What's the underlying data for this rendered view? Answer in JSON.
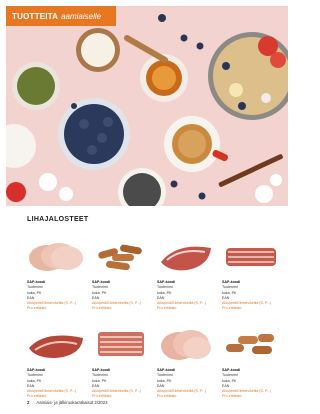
{
  "banner": {
    "part1": "TUOTTEITA",
    "part2": "aamiaiselle"
  },
  "section_title": "LIHAJALOSTEET",
  "products": [
    {
      "line1": "SAP-koodi",
      "line2": "Tuotenimi",
      "line3": "kuka, PK",
      "line4": "EAN",
      "price": "Alkuperä/Elintarviketila (S, P...)",
      "origin": "Pro-ertiiesto"
    },
    {
      "line1": "SAP-koodi",
      "line2": "Tuotenimi",
      "line3": "kuka, PK",
      "line4": "EAN",
      "price": "Alkuperä/Elintarviketila (S, P...)",
      "origin": "Pro-ertiiesto"
    },
    {
      "line1": "SAP-koodi",
      "line2": "Tuotenimi",
      "line3": "kuka, PK",
      "line4": "EAN",
      "price": "Alkuperä/Elintarviketila (S, P...)",
      "origin": "Pro-ertiiesto"
    },
    {
      "line1": "SAP-koodi",
      "line2": "Tuotenimi",
      "line3": "kuka, PK",
      "line4": "EAN",
      "price": "Alkuperä/Elintarviketila (S, P...)",
      "origin": "Pro-ertiiesto"
    },
    {
      "line1": "SAP-koodi",
      "line2": "Tuotenimi",
      "line3": "kuka, PK",
      "line4": "EAN",
      "price": "Alkuperä/Elintarviketila (S, P...)",
      "origin": "Pro-ertiiesto"
    },
    {
      "line1": "SAP-koodi",
      "line2": "Tuotenimi",
      "line3": "kuka, PK",
      "line4": "EAN",
      "price": "Alkuperä/Elintarviketila (S, P...)",
      "origin": "Pro-ertiiesto"
    },
    {
      "line1": "SAP-koodi",
      "line2": "Tuotenimi",
      "line3": "kuka, PK",
      "line4": "EAN",
      "price": "Alkuperä/Elintarviketila (S, P...)",
      "origin": "Pro-ertiiesto"
    },
    {
      "line1": "SAP-koodi",
      "line2": "Tuotenimi",
      "line3": "kuka, PK",
      "line4": "EAN",
      "price": "Alkuperä/Elintarviketila (S, P...)",
      "origin": "Pro-ertiiesto"
    }
  ],
  "footer": {
    "page": "2",
    "title": "Aamiais- ja jälkiruokaratkaisut 2/2023"
  },
  "colors": {
    "accent": "#e87722",
    "hero_bg": "#f3d3cf"
  }
}
